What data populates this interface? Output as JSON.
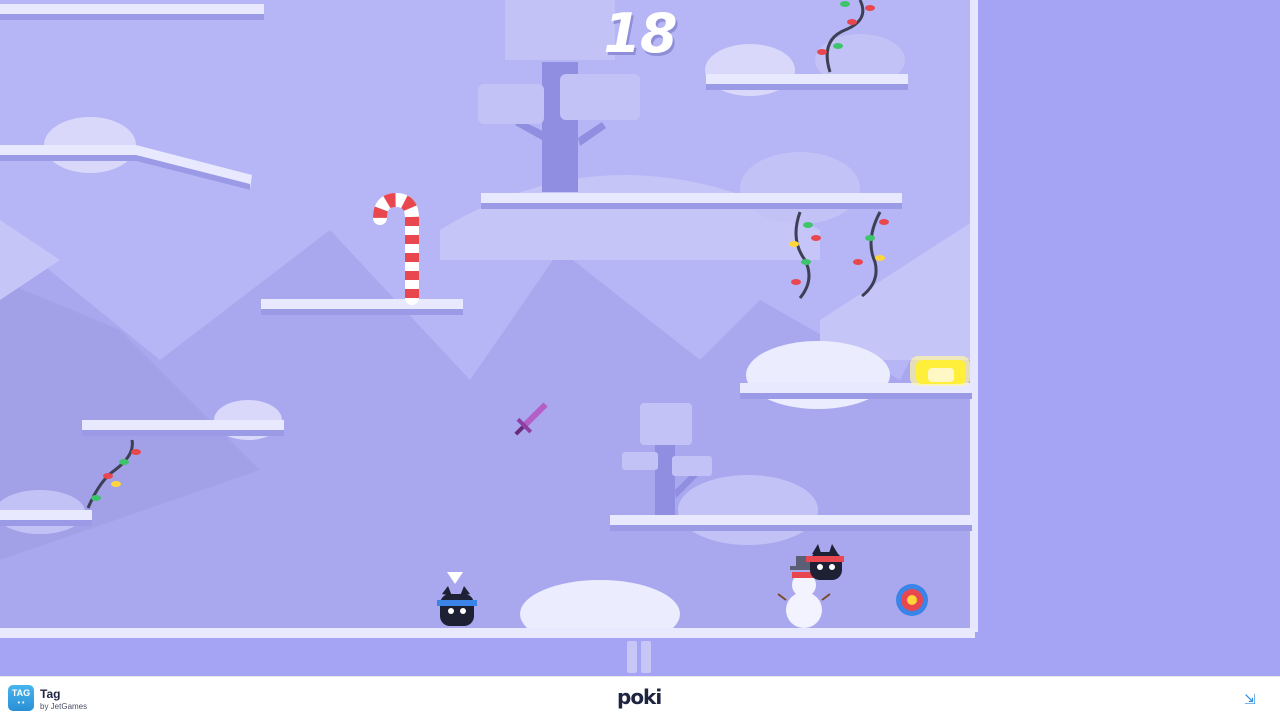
{
  "hud": {
    "score": "18"
  },
  "bottom_bar": {
    "game_title": "Tag",
    "developer": "by JetGames",
    "app_icon_text": "TAG",
    "app_icon_face": "• •",
    "portal_logo": "poki",
    "fullscreen_icon": "fullscreen-icon",
    "fullscreen_glyph": "⇲"
  },
  "colors": {
    "sky": "#b6b5f5",
    "platform_top": "#e8e8ff",
    "platform_bottom": "#9b9ae6",
    "hills": "#a3a2ea",
    "yellow_block": "#ffee3a",
    "candy_red": "#e8474f"
  }
}
